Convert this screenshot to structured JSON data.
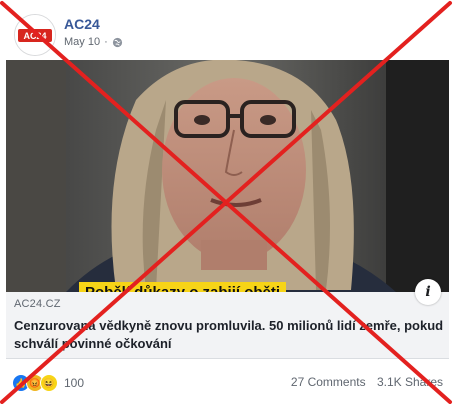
{
  "post": {
    "page_name": "AC24",
    "date": "May 10",
    "privacy_icon": "globe-icon",
    "avatar_text": "AC24"
  },
  "media": {
    "caption": "Pobělí důkazy o zabijí oběti"
  },
  "link": {
    "domain": "AC24.CZ",
    "headline": "Cenzurovaná vědkyně znovu promluvila. 50 milionů lidí zemře, pokud schválí povinné očkování"
  },
  "footer": {
    "reaction_count": "100",
    "comments": "27 Comments",
    "shares": "3.1K Shares"
  },
  "colors": {
    "cross": "#e3211f",
    "link_blue": "#385898",
    "caption_bg": "#f7d417"
  }
}
